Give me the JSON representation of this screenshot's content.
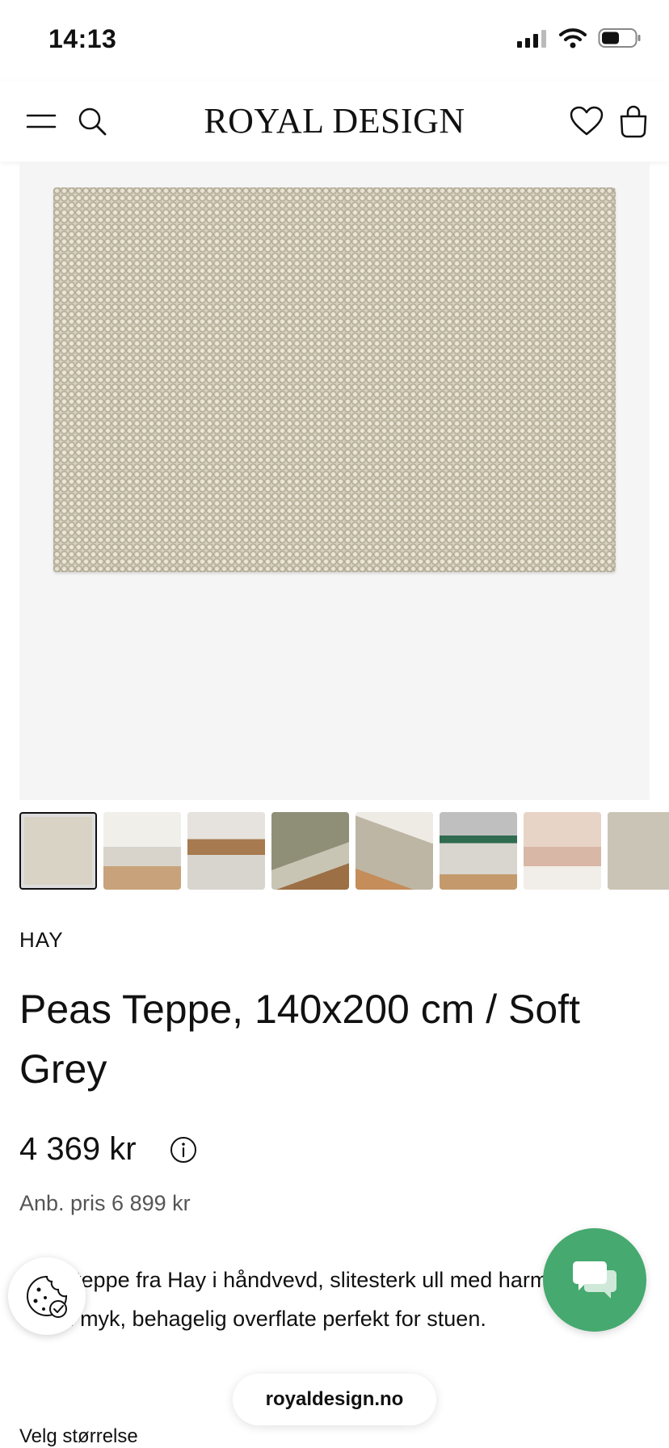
{
  "status_bar": {
    "time": "14:13"
  },
  "header": {
    "logo": "ROYAL DESIGN"
  },
  "thumbnails": [
    {
      "name": "thumbnail-1",
      "color": "#d8d3c5"
    },
    {
      "name": "thumbnail-2",
      "color": "#e8e3dc"
    },
    {
      "name": "thumbnail-3",
      "color": "#c9b59b"
    },
    {
      "name": "thumbnail-4",
      "color": "#9b9a84"
    },
    {
      "name": "thumbnail-5",
      "color": "#c3a888"
    },
    {
      "name": "thumbnail-6",
      "color": "#cfd2d0"
    },
    {
      "name": "thumbnail-7",
      "color": "#d7bdb0"
    },
    {
      "name": "thumbnail-8",
      "color": "#cac4b6"
    }
  ],
  "product": {
    "brand": "HAY",
    "title": "Peas Teppe, 140x200 cm / Soft Grey",
    "price": "4 369 kr",
    "rrp": "Anb. pris 6 899 kr",
    "description": "Peas teppe fra Hay i håndvevd, slitesterk ull med harmonisk stil og en myk, behagelig overflate perfekt for stuen.",
    "size_label": "Velg størrelse"
  },
  "browser": {
    "url": "royaldesign.no"
  },
  "colors": {
    "chat_green": "#46a96f"
  }
}
